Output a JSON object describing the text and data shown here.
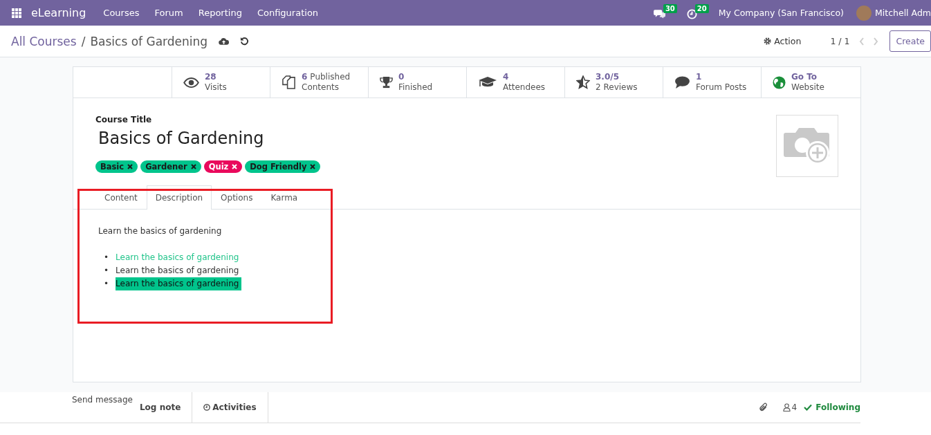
{
  "navbar": {
    "app_name": "eLearning",
    "menus": [
      "Courses",
      "Forum",
      "Reporting",
      "Configuration"
    ],
    "messages_count": "30",
    "activities_count": "20",
    "company": "My Company (San Francisco)",
    "user": "Mitchell Adm"
  },
  "control_panel": {
    "breadcrumb_separator": "/",
    "breadcrumb": [
      {
        "label": "All Courses",
        "kind": "link"
      },
      {
        "label": "Basics of Gardening",
        "kind": "current"
      }
    ],
    "action": "Action",
    "pager": "1 / 1",
    "create": "Create"
  },
  "stat_buttons": [
    {
      "kind": "eye",
      "value": "28",
      "label": "Visits"
    },
    {
      "kind": "copy",
      "value": "6",
      "value_suffix": "Published",
      "label": "Contents"
    },
    {
      "kind": "trophy",
      "value": "0",
      "label": "Finished"
    },
    {
      "kind": "cap",
      "value": "4",
      "label": "Attendees"
    },
    {
      "kind": "star",
      "value": "3.0/5",
      "label": "2 Reviews"
    },
    {
      "kind": "comment",
      "value": "1",
      "label": "Forum Posts"
    },
    {
      "kind": "globe",
      "value": "Go To",
      "label": "Website"
    }
  ],
  "form": {
    "title_label": "Course Title",
    "title": "Basics of Gardening",
    "tags": [
      {
        "label": "Basic",
        "color": "#00c48c"
      },
      {
        "label": "Gardener",
        "color": "#00c48c"
      },
      {
        "label": "Quiz",
        "color": "#e9095c"
      },
      {
        "label": "Dog Friendly",
        "color": "#00c48c"
      }
    ],
    "tabs": [
      {
        "label": "Content",
        "selected": false
      },
      {
        "label": "Description",
        "selected": true
      },
      {
        "label": "Options",
        "selected": false
      },
      {
        "label": "Karma",
        "selected": false
      }
    ],
    "description": {
      "paragraph": "Learn the basics of gardening",
      "items": [
        {
          "kind": "link",
          "bullet": "•",
          "text": "Learn the basics of gardening"
        },
        {
          "kind": "plain",
          "bullet": "•",
          "text": "Learn the basics of gardening"
        },
        {
          "kind": "highlight",
          "bullet": "•",
          "text": "Learn the basics of gardening"
        }
      ]
    }
  },
  "chatter": {
    "send_message": "Send message",
    "log_note": "Log note",
    "activities": "Activities",
    "followers": "4",
    "following": "Following"
  }
}
